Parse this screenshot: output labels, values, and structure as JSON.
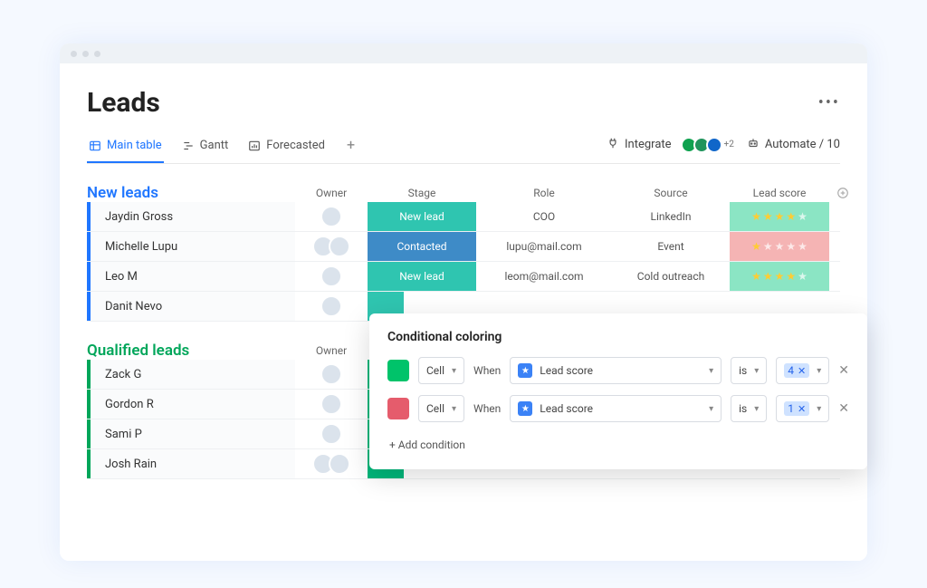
{
  "title": "Leads",
  "tabs": {
    "main": "Main table",
    "gantt": "Gantt",
    "forecasted": "Forecasted"
  },
  "tools": {
    "integrate": "Integrate",
    "automate": "Automate / 10",
    "integrations_extra": "+2"
  },
  "columns": {
    "owner": "Owner",
    "stage": "Stage",
    "role": "Role",
    "source": "Source",
    "score": "Lead score"
  },
  "groups": {
    "new": {
      "title": "New leads",
      "rows": [
        {
          "name": "Jaydin Gross",
          "stage": "New lead",
          "role": "COO",
          "source": "LinkedIn",
          "score": 4
        },
        {
          "name": "Michelle Lupu",
          "stage": "Contacted",
          "role": "lupu@mail.com",
          "source": "Event",
          "score": 1
        },
        {
          "name": "Leo M",
          "stage": "New lead",
          "role": "leom@mail.com",
          "source": "Cold outreach",
          "score": 4
        },
        {
          "name": "Danit Nevo",
          "stage": "",
          "role": "",
          "source": "",
          "score": null
        }
      ]
    },
    "qualified": {
      "title": "Qualified leads",
      "rows": [
        {
          "name": "Zack G"
        },
        {
          "name": "Gordon R"
        },
        {
          "name": "Sami P"
        },
        {
          "name": "Josh Rain"
        }
      ]
    }
  },
  "cond": {
    "title": "Conditional coloring",
    "cell": "Cell",
    "when": "When",
    "field": "Lead score",
    "is": "is",
    "val1": "4",
    "val2": "1",
    "add": "+ Add condition"
  }
}
